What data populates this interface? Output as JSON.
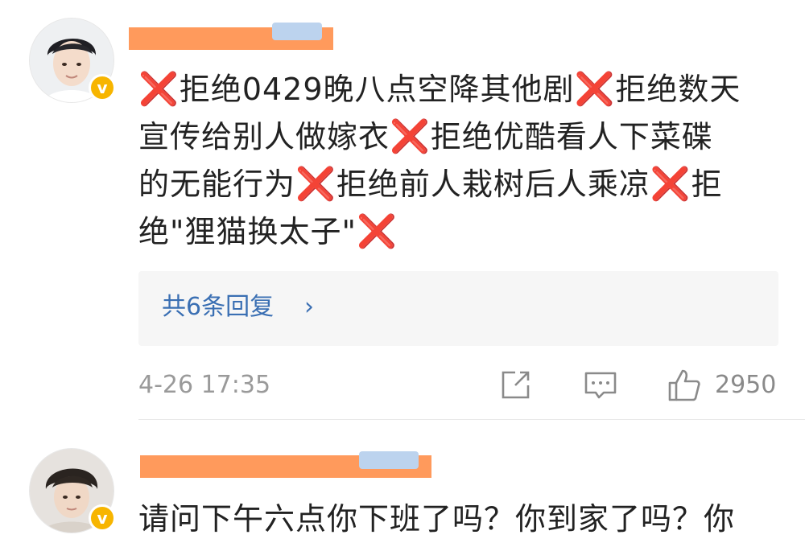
{
  "comments": [
    {
      "username": "",
      "verified_badge": "v",
      "body_lines": [
        [
          "",
          "❌",
          "拒绝0429晚八点空降其他剧",
          "❌",
          "拒绝数天"
        ],
        [
          "宣传给别人做嫁衣",
          "❌",
          "拒绝优酷看人下菜碟"
        ],
        [
          "的无能行为",
          "❌",
          "拒绝前人栽树后人乘凉",
          "❌",
          "拒"
        ],
        [
          "绝\"狸猫换太子\"",
          "❌"
        ]
      ],
      "replies_link": "共6条回复",
      "replies_chevron": "›",
      "timestamp": "4-26 17:35",
      "like_count": "2950",
      "icons": [
        "share-icon",
        "comment-icon",
        "like-icon"
      ]
    },
    {
      "username": "",
      "verified_badge": "v",
      "body_text": "请问下午六点你下班了吗？你到家了吗？你"
    }
  ],
  "colors": {
    "reply_link": "#3a6fb3",
    "cross_mark": "#e53935",
    "verified_badge": "#f7b500",
    "name_mask": "#ff9a5c",
    "meta_gray": "#9a9a9a"
  }
}
